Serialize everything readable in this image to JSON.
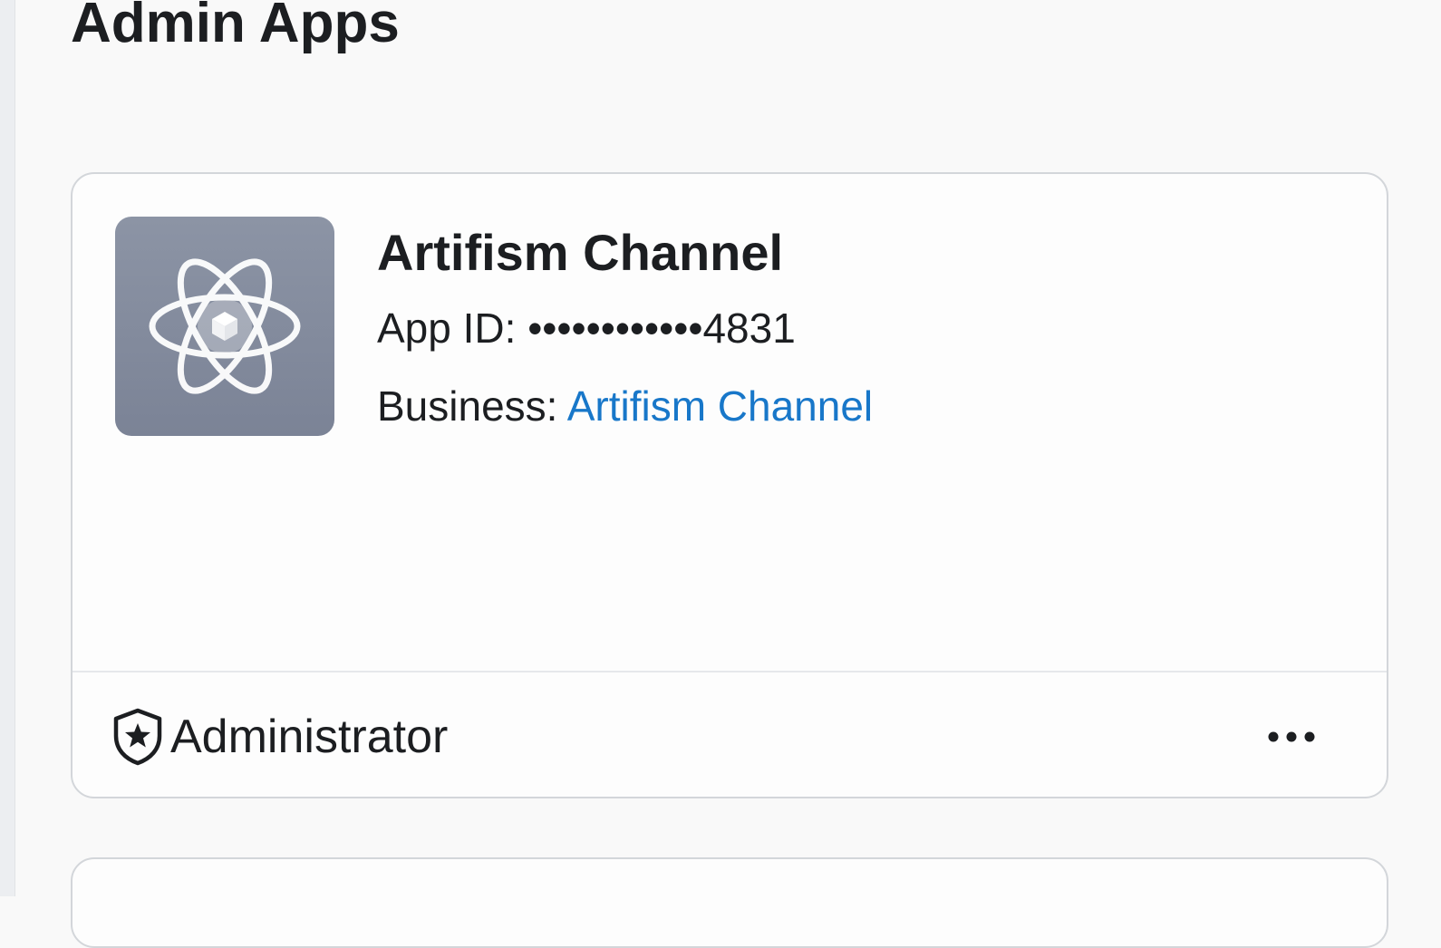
{
  "page": {
    "title": "Admin Apps"
  },
  "app_card": {
    "icon": "atom-icon",
    "name": "Artifism Channel",
    "app_id_label": "App ID:",
    "app_id_value": "••••••••••••4831",
    "business_label": "Business:",
    "business_name": "Artifism Channel",
    "role_icon": "shield-star-icon",
    "role": "Administrator",
    "more_icon": "more-horizontal-icon"
  },
  "colors": {
    "link": "#1877c9",
    "icon_bg": "#8c94a5",
    "text": "#1c1e21",
    "border": "#d3d6da"
  }
}
